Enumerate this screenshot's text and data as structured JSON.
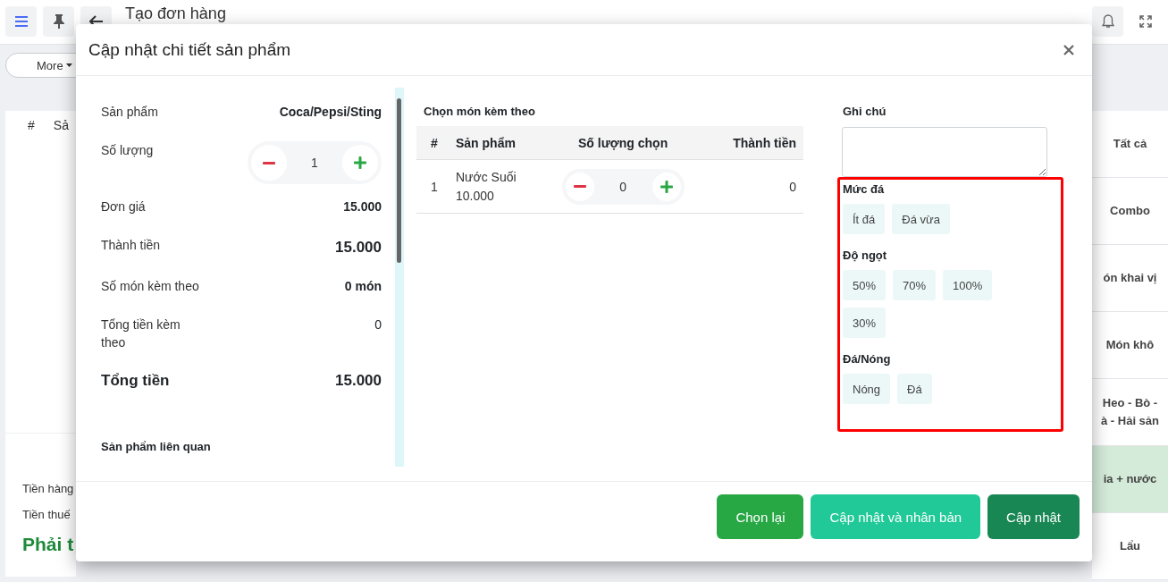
{
  "top_bar": {
    "title": "Tạo đơn hàng"
  },
  "toolbar": {
    "more_button": "More"
  },
  "order_table": {
    "columns": [
      "#",
      "Sả"
    ]
  },
  "summary": {
    "lines": [
      "Tiền hàng",
      "Tiền thuế"
    ],
    "total_label": "Phải t"
  },
  "categories": [
    {
      "label": "Tất cả",
      "selected": false
    },
    {
      "label": "Combo",
      "selected": false
    },
    {
      "label": "ón khai vị",
      "selected": false
    },
    {
      "label": "Món khô",
      "selected": false
    },
    {
      "label": "Heo - Bò -\nà - Hải sản",
      "selected": false
    },
    {
      "label": "ia + nước",
      "selected": true
    },
    {
      "label": "Lẩu",
      "selected": false
    }
  ],
  "dialog": {
    "title": "Cập nhật chi tiết sản phẩm",
    "details": [
      {
        "label": "Sản phẩm",
        "value": "Coca/Pepsi/Sting",
        "kind": "bold"
      },
      {
        "label": "Số lượng",
        "value": "1",
        "kind": "stepper"
      },
      {
        "label": "Đơn giá",
        "value": "15.000",
        "kind": "bold"
      },
      {
        "label": "Thành tiền",
        "value": "15.000",
        "kind": "large"
      },
      {
        "label": "Số món kèm theo",
        "value": "0 món",
        "kind": "bold"
      },
      {
        "label": "Tổng tiền kèm theo",
        "value": "0",
        "kind": "plain"
      },
      {
        "label": "Tổng tiền",
        "value": "15.000",
        "kind": "total"
      }
    ],
    "related_title": "Sản phẩm liên quan",
    "addons": {
      "title": "Chọn món kèm theo",
      "columns": [
        "#",
        "Sản phẩm",
        "Số lượng chọn",
        "Thành tiền"
      ],
      "rows": [
        {
          "index": "1",
          "name": "Nước Suối",
          "price": "10.000",
          "quantity": "0",
          "total": "0"
        }
      ]
    },
    "note_label": "Ghi chú",
    "option_groups": [
      {
        "title": "Mức đá",
        "options": [
          {
            "label": "Ít đá",
            "selected": false
          },
          {
            "label": "Đá vừa",
            "selected": false
          }
        ]
      },
      {
        "title": "Độ ngọt",
        "options": [
          {
            "label": "50%",
            "selected": false
          },
          {
            "label": "70%",
            "selected": false
          },
          {
            "label": "100%",
            "selected": false
          },
          {
            "label": "30%",
            "selected": false
          }
        ]
      },
      {
        "title": "Đá/Nóng",
        "options": [
          {
            "label": "Nóng",
            "selected": false
          },
          {
            "label": "Đá",
            "selected": false
          }
        ]
      }
    ],
    "buttons": [
      {
        "label": "Chọn lại",
        "kind": "reset"
      },
      {
        "label": "Cập nhật và nhân bản",
        "kind": "duplicate"
      },
      {
        "label": "Cập nhật",
        "kind": "primary"
      }
    ]
  }
}
